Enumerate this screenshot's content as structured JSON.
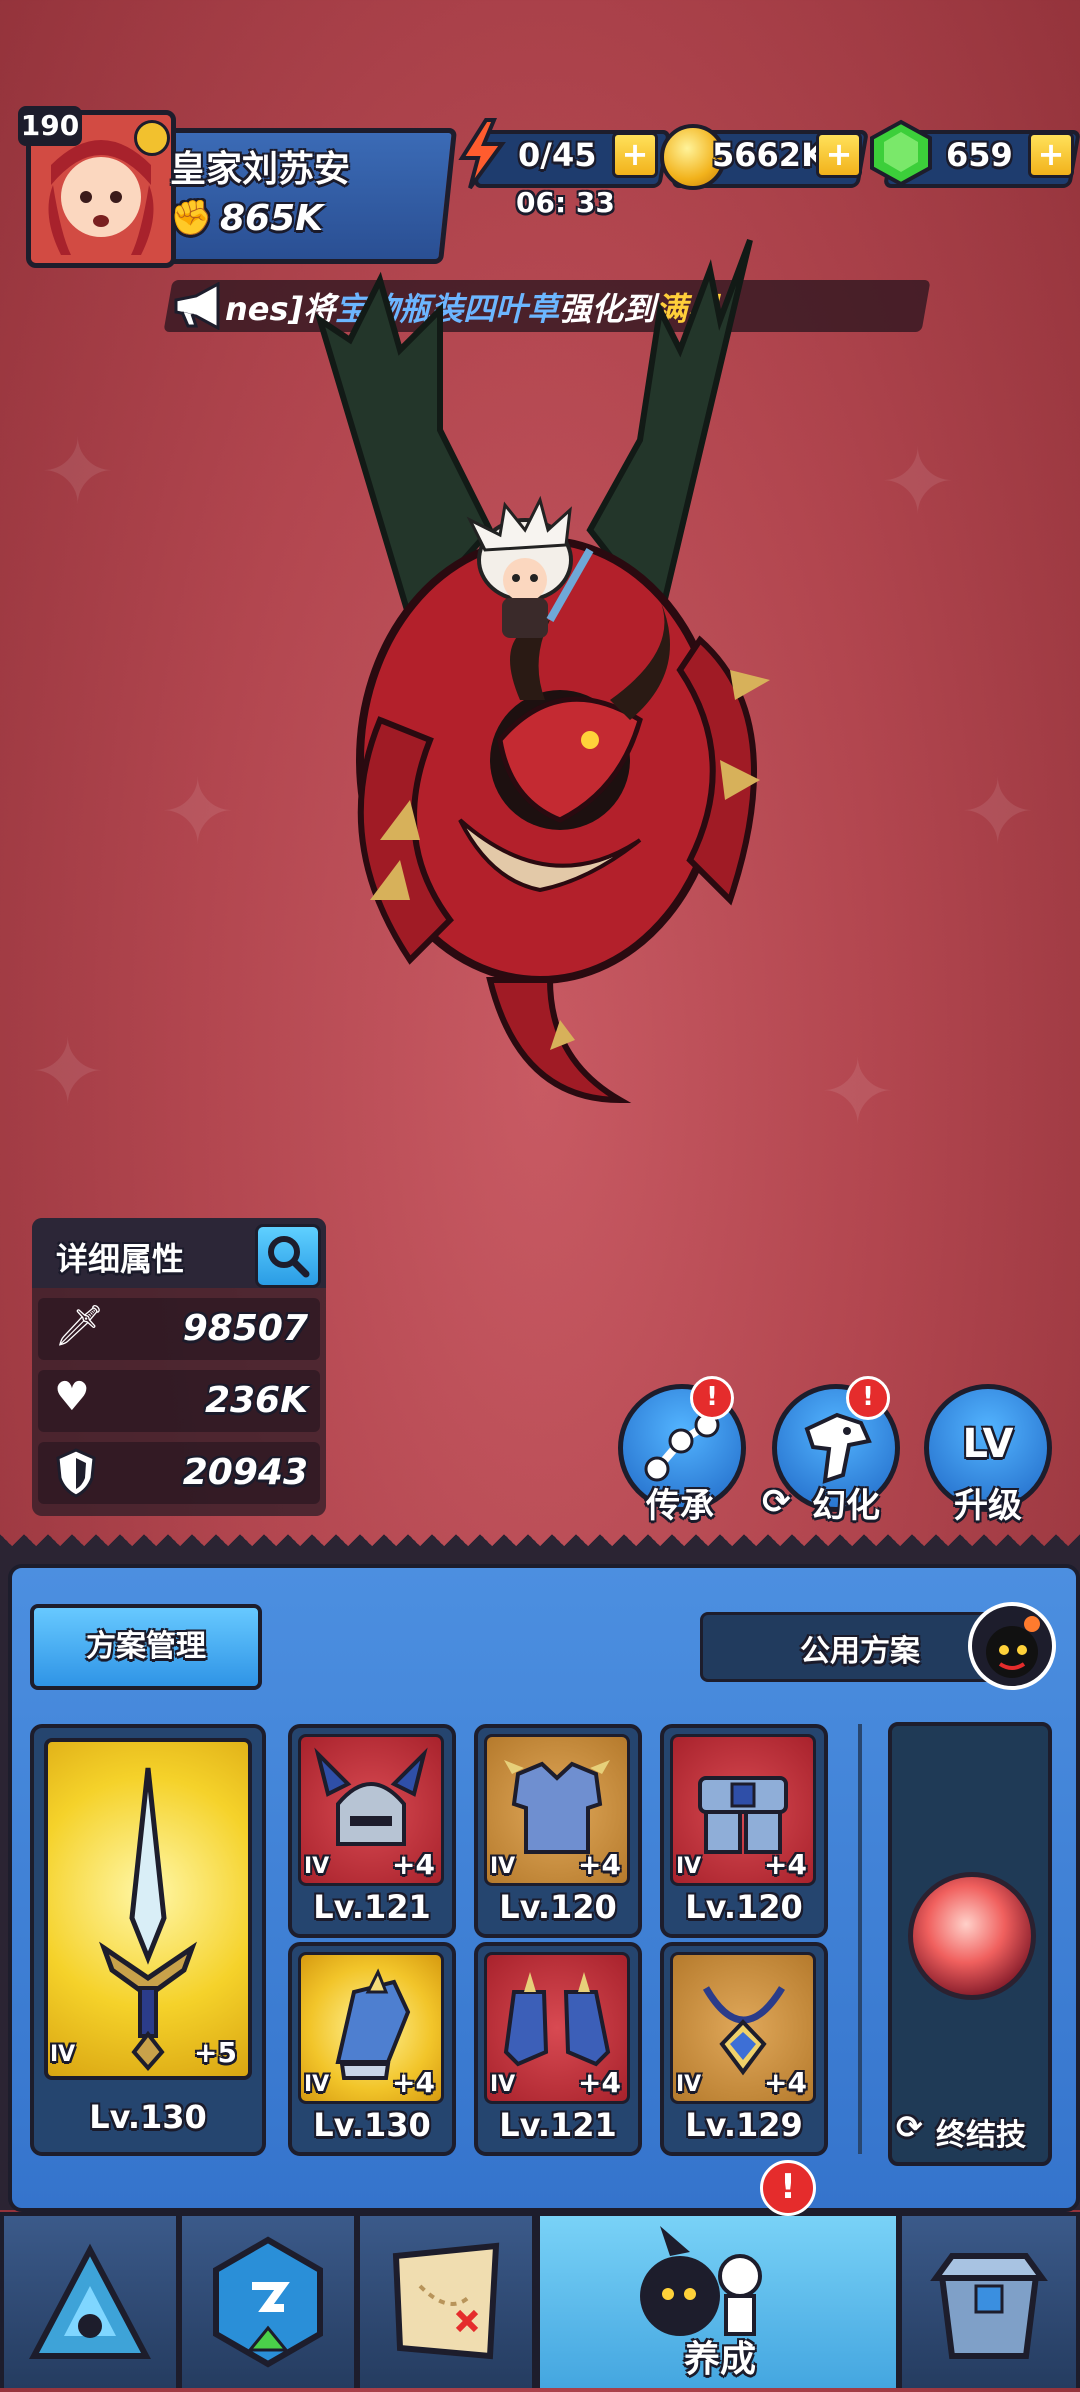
{
  "player": {
    "level": "190",
    "name": "皇家刘苏安",
    "power": "865K"
  },
  "resources": {
    "energy": "0/45",
    "energy_timer": "06: 33",
    "gold": "5662K",
    "gems": "659",
    "plus": "+"
  },
  "marquee": {
    "prefix": "nes]将",
    "item": "宝物瓶装四叶草",
    "middle": "强化到",
    "highlight": "满星",
    "suffix": "!"
  },
  "stats": {
    "title": "详细属性",
    "attack": "98507",
    "health": "236K",
    "defense": "20943"
  },
  "actions": [
    {
      "label": "传承",
      "alert": "!"
    },
    {
      "label": "幻化",
      "alert": "!"
    },
    {
      "label": "升级"
    }
  ],
  "panel": {
    "plan_manage": "方案管理",
    "public_plan": "公用方案"
  },
  "equipment": {
    "main_weapon": {
      "tier": "IV",
      "plus": "+5",
      "level": "Lv.130"
    },
    "slots": [
      {
        "tier": "IV",
        "plus": "+4",
        "level": "Lv.121"
      },
      {
        "tier": "IV",
        "plus": "+4",
        "level": "Lv.120"
      },
      {
        "tier": "IV",
        "plus": "+4",
        "level": "Lv.120"
      },
      {
        "tier": "IV",
        "plus": "+4",
        "level": "Lv.130"
      },
      {
        "tier": "IV",
        "plus": "+4",
        "level": "Lv.121"
      },
      {
        "tier": "IV",
        "plus": "+4",
        "level": "Lv.129"
      }
    ]
  },
  "ultimate": {
    "label": "终结技"
  },
  "nav": {
    "active_label": "养成",
    "active_alert": "!"
  },
  "colors": {
    "background": "#b2464f",
    "panel_blue": "#3574cc",
    "gold": "#f2b21b",
    "gem_green": "#3ccf3a",
    "highlight_blue": "#4aa8ff",
    "highlight_gold": "#ffcf3a",
    "alert_red": "#e52c2c"
  }
}
